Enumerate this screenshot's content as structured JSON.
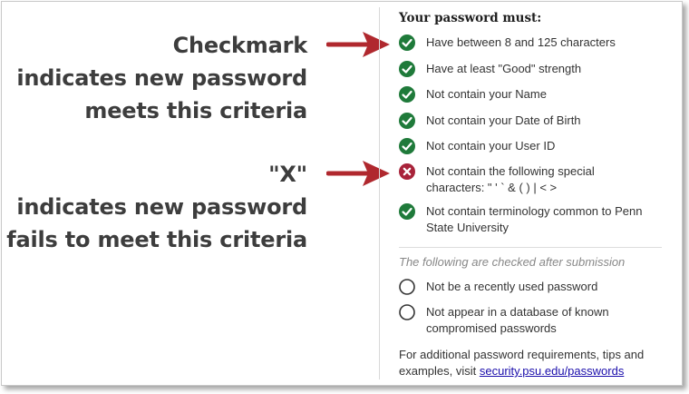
{
  "annotations": {
    "checkmark": [
      "Checkmark",
      "indicates new password",
      "meets this criteria"
    ],
    "x_mark": [
      "\"X\"",
      "indicates new password",
      "fails to meet this criteria"
    ],
    "arrow_color": "#b0282e"
  },
  "panel": {
    "title": "Your password must:",
    "requirements": [
      {
        "label": "Have between 8 and 125 characters",
        "status": "pass"
      },
      {
        "label": "Have at least \"Good\" strength",
        "status": "pass"
      },
      {
        "label": "Not contain your Name",
        "status": "pass"
      },
      {
        "label": "Not contain your Date of Birth",
        "status": "pass"
      },
      {
        "label": "Not contain your User ID",
        "status": "pass"
      },
      {
        "label": "Not contain the following special characters: \" ' ` & ( ) | < >",
        "status": "fail"
      },
      {
        "label": "Not contain terminology common to Penn State University",
        "status": "pass"
      }
    ],
    "after_submission_title": "The following are checked after submission",
    "after_submission": [
      {
        "label": "Not be a recently used password",
        "status": "pending"
      },
      {
        "label": "Not appear in a database of known compromised passwords",
        "status": "pending"
      }
    ],
    "footer_text": "For additional password requirements, tips and examples, visit ",
    "footer_link": "security.psu.edu/passwords"
  },
  "colors": {
    "pass": "#1f7a3a",
    "fail": "#a8233a",
    "pending": "#333333"
  }
}
